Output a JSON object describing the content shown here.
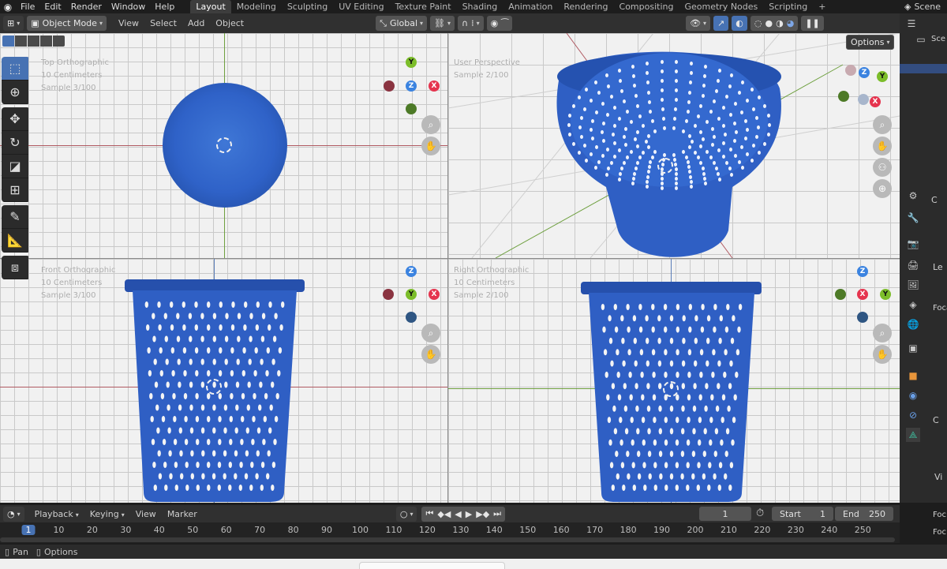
{
  "menu": [
    "File",
    "Edit",
    "Render",
    "Window",
    "Help"
  ],
  "workspaces": [
    "Layout",
    "Modeling",
    "Sculpting",
    "UV Editing",
    "Texture Paint",
    "Shading",
    "Animation",
    "Rendering",
    "Compositing",
    "Geometry Nodes",
    "Scripting"
  ],
  "active_workspace": "Layout",
  "scene_name": "Scene",
  "header": {
    "mode": "Object Mode",
    "menus": [
      "View",
      "Select",
      "Add",
      "Object"
    ],
    "orientation": "Global",
    "options_label": "Options"
  },
  "viewports": {
    "top": {
      "title": "Top Orthographic",
      "scale": "10 Centimeters",
      "sample": "Sample 3/100"
    },
    "persp": {
      "title": "User Perspective",
      "sample": "Sample 2/100"
    },
    "front": {
      "title": "Front Orthographic",
      "scale": "10 Centimeters",
      "sample": "Sample 3/100"
    },
    "right": {
      "title": "Right Orthographic",
      "scale": "10 Centimeters",
      "sample": "Sample 2/100"
    }
  },
  "gizmo_labels": {
    "x": "X",
    "y": "Y",
    "z": "Z"
  },
  "timeline": {
    "menus": [
      "Playback",
      "Keying",
      "View",
      "Marker"
    ],
    "current_frame": "1",
    "start_label": "Start",
    "start": "1",
    "end_label": "End",
    "end": "250",
    "ruler": [
      "1",
      "10",
      "20",
      "30",
      "40",
      "50",
      "60",
      "70",
      "80",
      "90",
      "100",
      "110",
      "120",
      "130",
      "140",
      "150",
      "160",
      "170",
      "180",
      "190",
      "200",
      "210",
      "220",
      "230",
      "240",
      "250"
    ]
  },
  "status": {
    "pan": "Pan",
    "options": "Options"
  },
  "right_panel_text": {
    "scene_short": "Sce",
    "focal": "Foca",
    "c1": "C",
    "l1": "Le",
    "v1": "Vi",
    "fo1": "Foc",
    "fo2": "Foc"
  },
  "colors": {
    "object_blue": "#2f5fc4",
    "accent": "#4772b3",
    "grid_bg": "#f1f1f1"
  }
}
